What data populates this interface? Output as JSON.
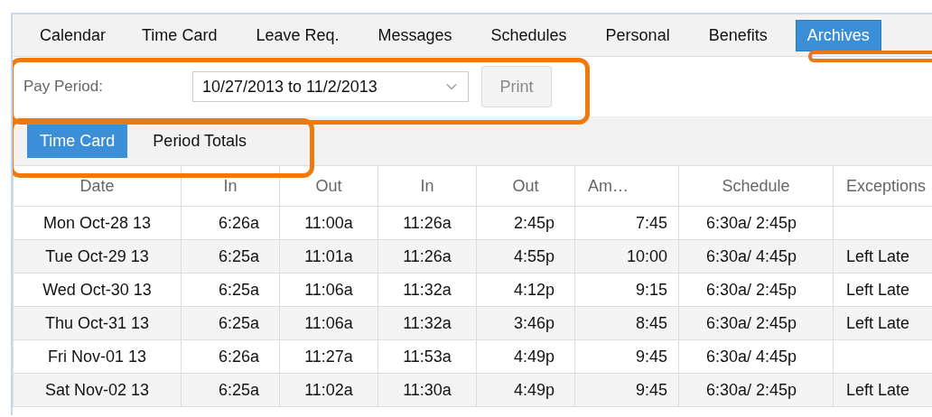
{
  "tabs": [
    {
      "label": "Calendar",
      "selected": false
    },
    {
      "label": "Time Card",
      "selected": false
    },
    {
      "label": "Leave Req.",
      "selected": false
    },
    {
      "label": "Messages",
      "selected": false
    },
    {
      "label": "Schedules",
      "selected": false
    },
    {
      "label": "Personal",
      "selected": false
    },
    {
      "label": "Benefits",
      "selected": false
    },
    {
      "label": "Archives",
      "selected": true
    }
  ],
  "pay_period": {
    "label": "Pay Period:",
    "value": "10/27/2013 to 11/2/2013",
    "print_button": "Print"
  },
  "subtabs": [
    {
      "label": "Time Card",
      "selected": true
    },
    {
      "label": "Period Totals",
      "selected": false
    }
  ],
  "table": {
    "columns": [
      "Date",
      "In",
      "Out",
      "In",
      "Out",
      "Am…",
      "Schedule",
      "Exceptions"
    ],
    "rows": [
      [
        "Mon Oct-28 13",
        "6:26a",
        "11:00a",
        "11:26a",
        "2:45p",
        "7:45",
        "6:30a/ 2:45p",
        ""
      ],
      [
        "Tue Oct-29 13",
        "6:25a",
        "11:01a",
        "11:26a",
        "4:55p",
        "10:00",
        "6:30a/ 4:45p",
        "Left Late"
      ],
      [
        "Wed Oct-30 13",
        "6:25a",
        "11:06a",
        "11:32a",
        "4:12p",
        "9:15",
        "6:30a/ 2:45p",
        "Left Late"
      ],
      [
        "Thu Oct-31 13",
        "6:25a",
        "11:06a",
        "11:32a",
        "3:46p",
        "8:45",
        "6:30a/ 2:45p",
        "Left Late"
      ],
      [
        "Fri Nov-01 13",
        "6:26a",
        "11:27a",
        "11:53a",
        "4:49p",
        "9:45",
        "6:30a/ 4:45p",
        ""
      ],
      [
        "Sat Nov-02 13",
        "6:25a",
        "11:02a",
        "11:30a",
        "4:49p",
        "9:45",
        "6:30a/ 2:45p",
        "Left Late"
      ]
    ]
  }
}
